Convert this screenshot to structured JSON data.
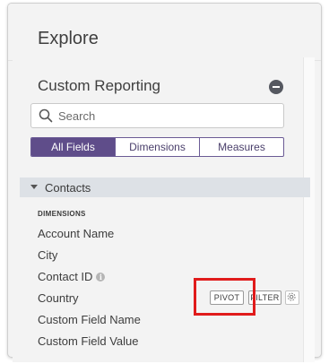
{
  "explore": {
    "title": "Explore"
  },
  "panel": {
    "title": "Custom Reporting"
  },
  "search": {
    "placeholder": "Search",
    "value": ""
  },
  "tabs": [
    {
      "label": "All Fields",
      "active": true
    },
    {
      "label": "Dimensions",
      "active": false
    },
    {
      "label": "Measures",
      "active": false
    }
  ],
  "group": {
    "label": "Contacts",
    "expanded": true
  },
  "dimensions": {
    "heading": "DIMENSIONS",
    "fields": [
      {
        "label": "Account Name"
      },
      {
        "label": "City"
      },
      {
        "label": "Contact ID",
        "info": true
      },
      {
        "label": "Country"
      },
      {
        "label": "Custom Field Name"
      },
      {
        "label": "Custom Field Value"
      }
    ]
  },
  "row_actions": {
    "pivot": "PIVOT",
    "filter": "FILTER"
  },
  "icons": [
    "minus-circle-icon",
    "search-icon",
    "caret-down-icon",
    "info-icon",
    "gear-icon"
  ],
  "colors": {
    "accent": "#5f4d8a",
    "highlight": "#e01b1b",
    "group_bg": "#dde1e6"
  }
}
